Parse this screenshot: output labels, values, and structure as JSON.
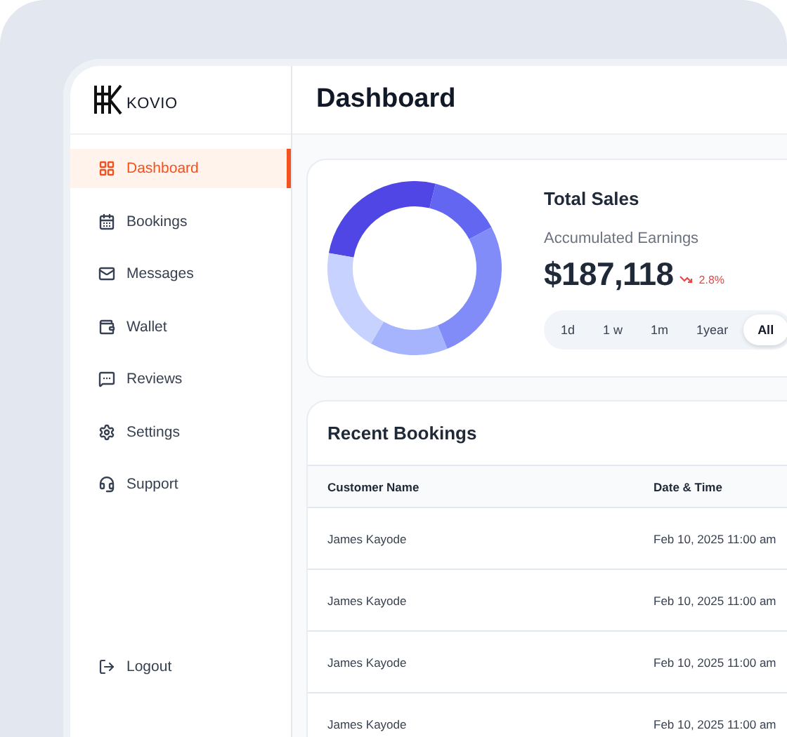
{
  "brand": {
    "name": "KOVIO"
  },
  "sidebar": {
    "items": [
      {
        "label": "Dashboard",
        "selected": true
      },
      {
        "label": "Bookings",
        "selected": false
      },
      {
        "label": "Messages",
        "selected": false
      },
      {
        "label": "Wallet",
        "selected": false
      },
      {
        "label": "Reviews",
        "selected": false
      },
      {
        "label": "Settings",
        "selected": false
      },
      {
        "label": "Support",
        "selected": false
      }
    ],
    "footer": {
      "label": "Logout"
    }
  },
  "header": {
    "title": "Dashboard"
  },
  "sales": {
    "title": "Total Sales",
    "subtitle": "Accumulated Earnings",
    "amount": "$187,118",
    "change": {
      "text": "2.8%",
      "negative": true
    },
    "periods": [
      {
        "label": "1d",
        "selected": false
      },
      {
        "label": "1 w",
        "selected": false
      },
      {
        "label": "1m",
        "selected": false
      },
      {
        "label": "1year",
        "selected": false
      },
      {
        "label": "All",
        "selected": true
      }
    ]
  },
  "bookings": {
    "title": "Recent Bookings",
    "columns": [
      "Customer Name",
      "Date & Time"
    ],
    "rows": [
      [
        "James Kayode",
        "Feb 10, 2025 11:00 am"
      ],
      [
        "James Kayode",
        "Feb 10, 2025 11:00 am"
      ],
      [
        "James Kayode",
        "Feb 10, 2025 11:00 am"
      ],
      [
        "James Kayode",
        "Feb 10, 2025 11:00 am"
      ]
    ]
  }
}
